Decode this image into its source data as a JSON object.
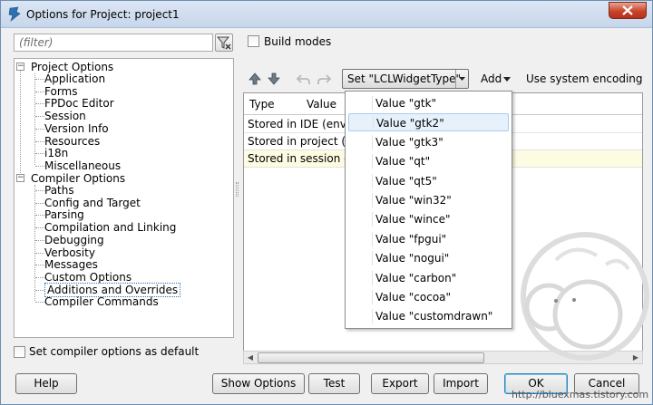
{
  "window": {
    "title": "Options for Project: project1"
  },
  "filter": {
    "placeholder": "(filter)"
  },
  "build_modes": {
    "label": "Build modes"
  },
  "tree": {
    "project_options": "Project Options",
    "project_children": [
      "Application",
      "Forms",
      "FPDoc Editor",
      "Session",
      "Version Info",
      "Resources",
      "i18n",
      "Miscellaneous"
    ],
    "compiler_options": "Compiler Options",
    "compiler_children": [
      "Paths",
      "Config and Target",
      "Parsing",
      "Compilation and Linking",
      "Debugging",
      "Verbosity",
      "Messages",
      "Custom Options",
      "Additions and Overrides",
      "Compiler Commands"
    ],
    "selected": "Additions and Overrides"
  },
  "set_default": {
    "label": "Set compiler options as default"
  },
  "toolbar": {
    "set_button": "Set \"LCLWidgetType\"",
    "add_label": "Add",
    "system_encoding": "Use system encoding"
  },
  "grid": {
    "columns": [
      "Type",
      "Value"
    ],
    "rows": [
      "Stored in IDE (envir",
      "Stored in project (.l",
      "Stored in session o"
    ]
  },
  "dropdown": {
    "items": [
      "Value \"gtk\"",
      "Value \"gtk2\"",
      "Value \"gtk3\"",
      "Value \"qt\"",
      "Value \"qt5\"",
      "Value \"win32\"",
      "Value \"wince\"",
      "Value \"fpgui\"",
      "Value \"nogui\"",
      "Value \"carbon\"",
      "Value \"cocoa\"",
      "Value \"customdrawn\""
    ],
    "hovered": "Value \"gtk2\""
  },
  "buttons": {
    "help": "Help",
    "show_options": "Show Options",
    "test": "Test",
    "export": "Export",
    "import": "Import",
    "ok": "OK",
    "cancel": "Cancel"
  },
  "watermark": {
    "text": "http://bluexmas.tistory.com"
  },
  "colors": {
    "title_bg": "#c6d6ea",
    "close_red": "#c9442b",
    "hover_blue": "#e7f1fb",
    "session_row": "#fdfbe2"
  }
}
